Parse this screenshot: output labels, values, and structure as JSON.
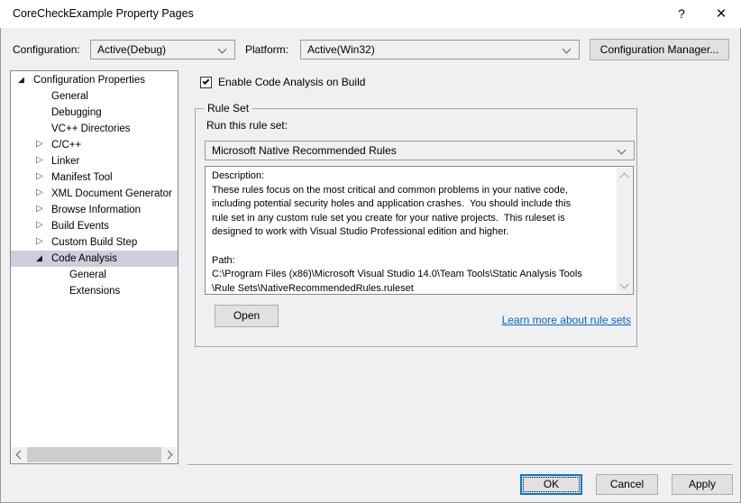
{
  "window": {
    "title": "CoreCheckExample Property Pages",
    "help_glyph": "?",
    "close_glyph": "×"
  },
  "toolbar": {
    "configuration_label": "Configuration:",
    "configuration_value": "Active(Debug)",
    "platform_label": "Platform:",
    "platform_value": "Active(Win32)",
    "configuration_manager_label": "Configuration Manager..."
  },
  "tree": {
    "items": [
      {
        "label": "Configuration Properties",
        "level": 0,
        "state": "expanded",
        "selected": false
      },
      {
        "label": "General",
        "level": 1,
        "state": "none",
        "selected": false
      },
      {
        "label": "Debugging",
        "level": 1,
        "state": "none",
        "selected": false
      },
      {
        "label": "VC++ Directories",
        "level": 1,
        "state": "none",
        "selected": false
      },
      {
        "label": "C/C++",
        "level": 1,
        "state": "collapsed",
        "selected": false
      },
      {
        "label": "Linker",
        "level": 1,
        "state": "collapsed",
        "selected": false
      },
      {
        "label": "Manifest Tool",
        "level": 1,
        "state": "collapsed",
        "selected": false
      },
      {
        "label": "XML Document Generator",
        "level": 1,
        "state": "collapsed",
        "selected": false
      },
      {
        "label": "Browse Information",
        "level": 1,
        "state": "collapsed",
        "selected": false
      },
      {
        "label": "Build Events",
        "level": 1,
        "state": "collapsed",
        "selected": false
      },
      {
        "label": "Custom Build Step",
        "level": 1,
        "state": "collapsed",
        "selected": false
      },
      {
        "label": "Code Analysis",
        "level": 1,
        "state": "expanded",
        "selected": true
      },
      {
        "label": "General",
        "level": 2,
        "state": "none",
        "selected": false
      },
      {
        "label": "Extensions",
        "level": 2,
        "state": "none",
        "selected": false
      }
    ]
  },
  "main": {
    "enable_checkbox_label": "Enable Code Analysis on Build",
    "enable_checked": true,
    "group_title": "Rule Set",
    "run_rule_set_label": "Run this rule set:",
    "rule_set_value": "Microsoft Native Recommended Rules",
    "description_text": "Description:\nThese rules focus on the most critical and common problems in your native code,\nincluding potential security holes and application crashes.  You should include this\nrule set in any custom rule set you create for your native projects.  This ruleset is\ndesigned to work with Visual Studio Professional edition and higher.\n\nPath:\nC:\\Program Files (x86)\\Microsoft Visual Studio 14.0\\Team Tools\\Static Analysis Tools\n\\Rule Sets\\NativeRecommendedRules.ruleset",
    "open_button_label": "Open",
    "learn_more_link": "Learn more about rule sets"
  },
  "footer": {
    "ok_label": "OK",
    "cancel_label": "Cancel",
    "apply_label": "Apply"
  },
  "icons": {
    "expanded_glyph": "◢",
    "collapsed_glyph": "▷"
  },
  "colors": {
    "accent": "#0078d7",
    "link": "#0066cc",
    "tree_selection": "#cccedb"
  }
}
